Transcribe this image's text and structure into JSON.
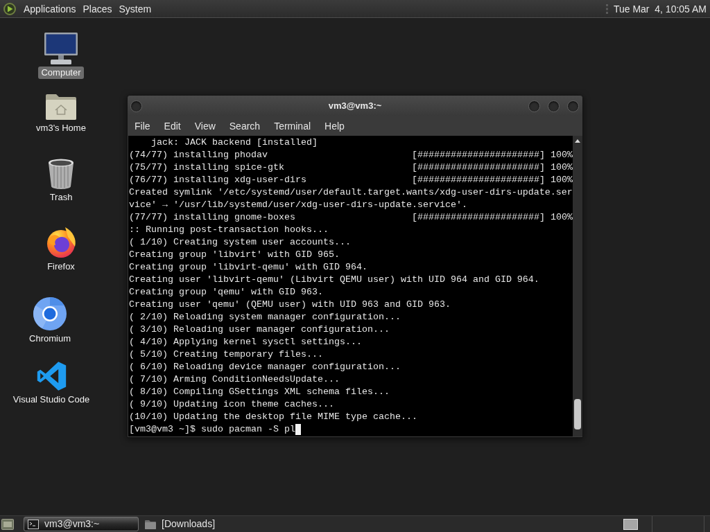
{
  "top_panel": {
    "menus": [
      "Applications",
      "Places",
      "System"
    ],
    "clock": "Tue Mar  4, 10:05 AM"
  },
  "desktop_icons": [
    {
      "kind": "computer",
      "label": "Computer",
      "selected": true
    },
    {
      "kind": "home",
      "label": "vm3's Home",
      "selected": false
    },
    {
      "kind": "trash",
      "label": "Trash",
      "selected": false
    },
    {
      "kind": "firefox",
      "label": "Firefox",
      "selected": false
    },
    {
      "kind": "chromium",
      "label": "Chromium",
      "selected": false
    },
    {
      "kind": "vscode",
      "label": "Visual Studio Code",
      "selected": false
    }
  ],
  "terminal_window": {
    "title": "vm3@vm3:~",
    "menu": [
      "File",
      "Edit",
      "View",
      "Search",
      "Terminal",
      "Help"
    ],
    "lines": [
      {
        "kind": "text",
        "text": "    jack: JACK backend [installed]"
      },
      {
        "kind": "progress",
        "text": "(74/77) installing phodav",
        "bar": "[######################]",
        "percent": "100%"
      },
      {
        "kind": "progress",
        "text": "(75/77) installing spice-gtk",
        "bar": "[######################]",
        "percent": "100%"
      },
      {
        "kind": "progress",
        "text": "(76/77) installing xdg-user-dirs",
        "bar": "[######################]",
        "percent": "100%"
      },
      {
        "kind": "text",
        "text": "Created symlink '/etc/systemd/user/default.target.wants/xdg-user-dirs-update.ser"
      },
      {
        "kind": "text",
        "text": "vice' → '/usr/lib/systemd/user/xdg-user-dirs-update.service'."
      },
      {
        "kind": "progress",
        "text": "(77/77) installing gnome-boxes",
        "bar": "[######################]",
        "percent": "100%"
      },
      {
        "kind": "text",
        "text": ":: Running post-transaction hooks..."
      },
      {
        "kind": "text",
        "text": "( 1/10) Creating system user accounts..."
      },
      {
        "kind": "text",
        "text": "Creating group 'libvirt' with GID 965."
      },
      {
        "kind": "text",
        "text": "Creating group 'libvirt-qemu' with GID 964."
      },
      {
        "kind": "text",
        "text": "Creating user 'libvirt-qemu' (Libvirt QEMU user) with UID 964 and GID 964."
      },
      {
        "kind": "text",
        "text": "Creating group 'qemu' with GID 963."
      },
      {
        "kind": "text",
        "text": "Creating user 'qemu' (QEMU user) with UID 963 and GID 963."
      },
      {
        "kind": "text",
        "text": "( 2/10) Reloading system manager configuration..."
      },
      {
        "kind": "text",
        "text": "( 3/10) Reloading user manager configuration..."
      },
      {
        "kind": "text",
        "text": "( 4/10) Applying kernel sysctl settings..."
      },
      {
        "kind": "text",
        "text": "( 5/10) Creating temporary files..."
      },
      {
        "kind": "text",
        "text": "( 6/10) Reloading device manager configuration..."
      },
      {
        "kind": "text",
        "text": "( 7/10) Arming ConditionNeedsUpdate..."
      },
      {
        "kind": "text",
        "text": "( 8/10) Compiling GSettings XML schema files..."
      },
      {
        "kind": "text",
        "text": "( 9/10) Updating icon theme caches..."
      },
      {
        "kind": "text",
        "text": "(10/10) Updating the desktop file MIME type cache..."
      }
    ],
    "prompt": "[vm3@vm3 ~]$ sudo pacman -S pl"
  },
  "taskbar": {
    "tasks": [
      {
        "kind": "terminal",
        "label": "vm3@vm3:~",
        "selected": true
      },
      {
        "kind": "folder",
        "label": "[Downloads]",
        "selected": false
      }
    ]
  }
}
